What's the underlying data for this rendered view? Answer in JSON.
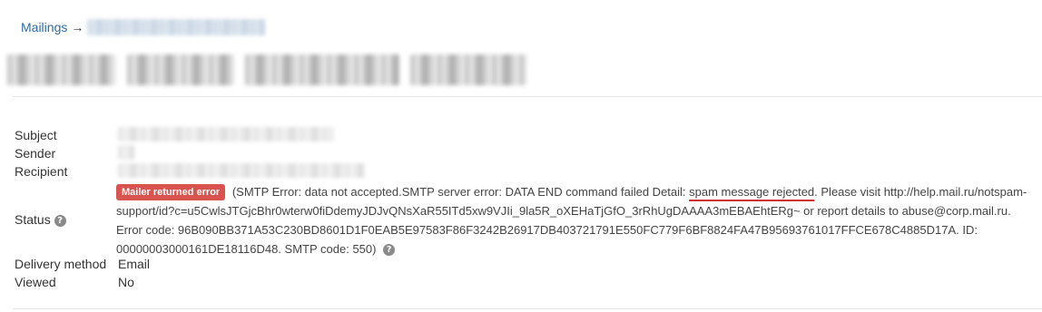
{
  "breadcrumb": {
    "root_label": "Mailings",
    "separator": "→"
  },
  "fields": {
    "subject_label": "Subject",
    "sender_label": "Sender",
    "recipient_label": "Recipient",
    "status_label": "Status",
    "delivery_method_label": "Delivery method",
    "delivery_method_value": "Email",
    "viewed_label": "Viewed",
    "viewed_value": "No"
  },
  "status": {
    "badge_text": "Mailer returned error",
    "badge_color": "#d9534f",
    "message_before": " (SMTP Error: data not accepted.SMTP server error: DATA END command failed Detail: ",
    "message_highlight": "spam message rejected",
    "message_after": ". Please visit http://help.mail.ru/notspam-support/id?c=u5CwlsJTGjcBhr0wterw0fiDdemyJDJvQNsXaR55ITd5xw9VJIi_9la5R_oXEHaTjGfO_3rRhUgDAAAA3mEBAEhtERg~ or report details to abuse@corp.mail.ru. Error code: 96B090BB371A53C230BD8601D1F0EAB5E97583F86F3242B26917DB403721791E550FC779F6BF8824FA47B95693761017FFCE678C4885D17A. ID: 00000003000161DE18116D48. SMTP code: 550)",
    "highlight_underline_color": "#d0312d"
  },
  "icons": {
    "help": "?"
  },
  "colors": {
    "link": "#2f6aa3"
  }
}
